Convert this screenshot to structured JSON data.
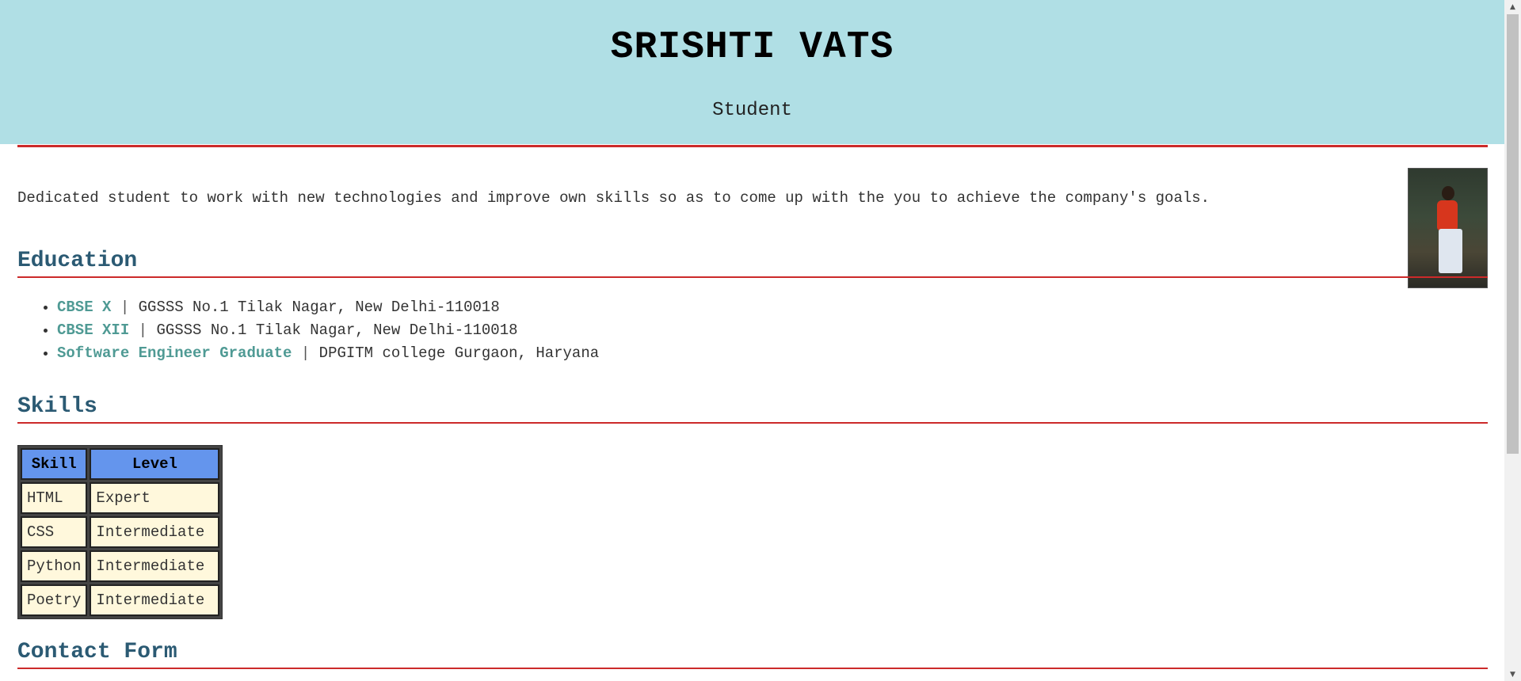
{
  "header": {
    "name": "SRISHTI VATS",
    "role": "Student"
  },
  "summary": "Dedicated student to work with new technologies and improve own skills so as to come up with the you to achieve the company's goals.",
  "photo": {
    "alt": "profile-photo"
  },
  "education": {
    "title": "Education",
    "items": [
      {
        "degree": "CBSE X",
        "separator": "|",
        "institution": "GGSSS No.1 Tilak Nagar, New Delhi-110018"
      },
      {
        "degree": "CBSE XII",
        "separator": "|",
        "institution": "GGSSS No.1 Tilak Nagar, New Delhi-110018"
      },
      {
        "degree": "Software Engineer Graduate",
        "separator": "|",
        "institution": "DPGITM college Gurgaon, Haryana"
      }
    ]
  },
  "skills": {
    "title": "Skills",
    "headers": [
      "Skill",
      "Level"
    ],
    "rows": [
      [
        "HTML",
        "Expert"
      ],
      [
        "CSS",
        "Intermediate"
      ],
      [
        "Python",
        "Intermediate"
      ],
      [
        "Poetry",
        "Intermediate"
      ]
    ]
  },
  "contact": {
    "title": "Contact Form"
  },
  "colors": {
    "header_bg": "#b0dfe5",
    "rule": "#cc2a2a",
    "section_title": "#2b5a73",
    "degree_link": "#4f9a94",
    "table_header": "#6495ed",
    "table_cell": "#fff8dc"
  },
  "icons": {
    "scroll_up": "▲",
    "scroll_down": "▼"
  }
}
